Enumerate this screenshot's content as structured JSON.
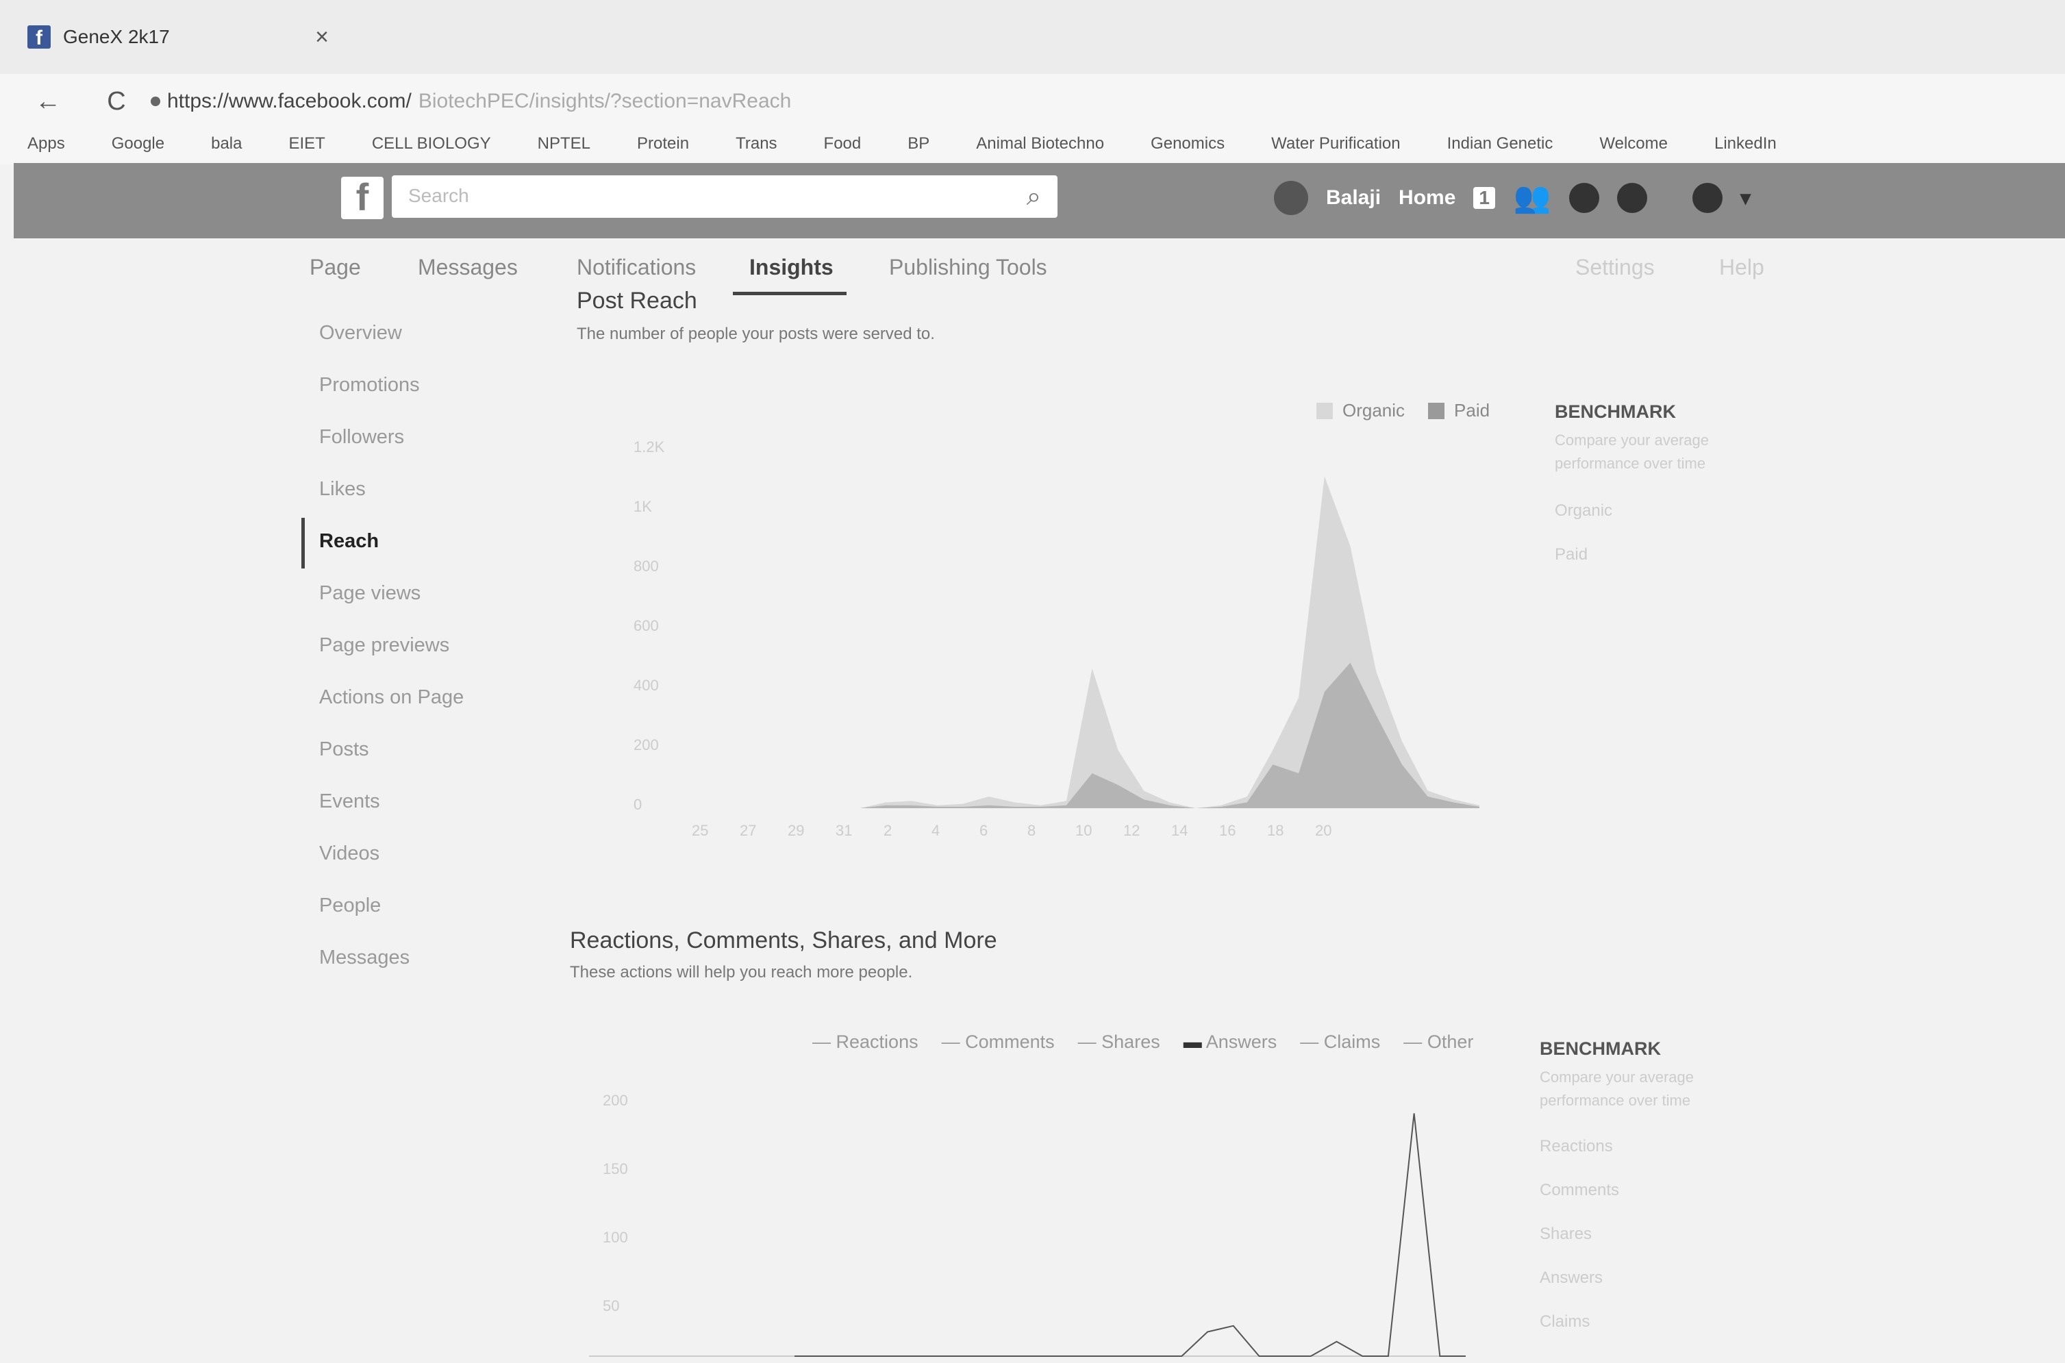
{
  "browser": {
    "tab_title": "GeneX 2k17",
    "tab_close": "×",
    "back": "←",
    "reload": "C",
    "url_host": "https://www.facebook.com/",
    "url_path": "BiotechPEC/insights/?section=navReach",
    "bookmarks": [
      "Apps",
      "Google",
      "bala",
      "EIET",
      "CELL BIOLOGY",
      "NPTEL",
      "Protein",
      "Trans",
      "Food",
      "BP",
      "Animal Biotechno",
      "Genomics",
      "Water Purification",
      "Indian Genetic",
      "Welcome",
      "LinkedIn"
    ]
  },
  "fb": {
    "search_placeholder": "Search",
    "user_name": "Balaji",
    "home_label": "Home",
    "home_count": "1"
  },
  "page_tabs": [
    "Page",
    "Messages",
    "Notifications",
    "Insights",
    "Publishing Tools",
    "Settings",
    "Help"
  ],
  "sidebar": [
    "Overview",
    "Promotions",
    "Followers",
    "Likes",
    "Reach",
    "Page views",
    "Page previews",
    "Actions on Page",
    "Posts",
    "Events",
    "Videos",
    "People",
    "Messages"
  ],
  "post_reach": {
    "title": "Post Reach",
    "subtitle": "The number of people your posts were served to.",
    "legend": [
      "Organic",
      "Paid"
    ],
    "y_ticks": [
      "1.2K",
      "1K",
      "800",
      "600",
      "400",
      "200",
      "0"
    ],
    "x_ticks": [
      "25",
      "27",
      "29",
      "31",
      "2",
      "4",
      "6",
      "8",
      "10",
      "12",
      "14",
      "16",
      "18",
      "20"
    ],
    "benchmark_title": "BENCHMARK",
    "benchmark_sub": "Compare your average performance over time",
    "benchmark_items": [
      "Organic",
      "Paid"
    ]
  },
  "reactions": {
    "title": "Reactions, Comments, Shares, and More",
    "subtitle": "These actions will help you reach more people.",
    "legend": [
      "Reactions",
      "Comments",
      "Shares",
      "Answers",
      "Claims",
      "Other"
    ],
    "y_ticks": [
      "200",
      "150",
      "100",
      "50"
    ],
    "benchmark_title": "BENCHMARK",
    "benchmark_sub": "Compare your average performance over time",
    "benchmark_items": [
      "Reactions",
      "Comments",
      "Shares",
      "Answers",
      "Claims"
    ]
  },
  "chart_data": [
    {
      "type": "area",
      "title": "Post Reach",
      "x": [
        "25",
        "26",
        "27",
        "28",
        "29",
        "30",
        "31",
        "1",
        "2",
        "3",
        "4",
        "5",
        "6",
        "7",
        "8",
        "9",
        "10",
        "11",
        "12",
        "13",
        "14",
        "15",
        "16",
        "17",
        "18",
        "19",
        "20"
      ],
      "series": [
        {
          "name": "Organic",
          "values": [
            0,
            0,
            0,
            20,
            25,
            10,
            15,
            40,
            20,
            10,
            25,
            480,
            200,
            60,
            20,
            0,
            10,
            40,
            200,
            380,
            1140,
            900,
            470,
            230,
            60,
            30,
            10
          ]
        },
        {
          "name": "Paid",
          "values": [
            0,
            0,
            0,
            10,
            10,
            5,
            5,
            10,
            5,
            5,
            10,
            120,
            80,
            30,
            10,
            0,
            5,
            20,
            150,
            120,
            400,
            500,
            320,
            150,
            40,
            20,
            5
          ]
        }
      ],
      "ylim": [
        0,
        1200
      ]
    },
    {
      "type": "line",
      "title": "Reactions, Comments, Shares, and More",
      "x": [
        "25",
        "26",
        "27",
        "28",
        "29",
        "30",
        "31",
        "1",
        "2",
        "3",
        "4",
        "5",
        "6",
        "7",
        "8",
        "9",
        "10",
        "11",
        "12",
        "13",
        "14",
        "15",
        "16",
        "17",
        "18",
        "19",
        "20"
      ],
      "series": [
        {
          "name": "Reactions",
          "values": [
            0,
            0,
            0,
            0,
            0,
            0,
            0,
            0,
            0,
            0,
            0,
            0,
            0,
            0,
            0,
            0,
            20,
            25,
            0,
            0,
            0,
            12,
            0,
            0,
            200,
            0,
            0
          ]
        }
      ],
      "ylim": [
        0,
        220
      ]
    }
  ]
}
